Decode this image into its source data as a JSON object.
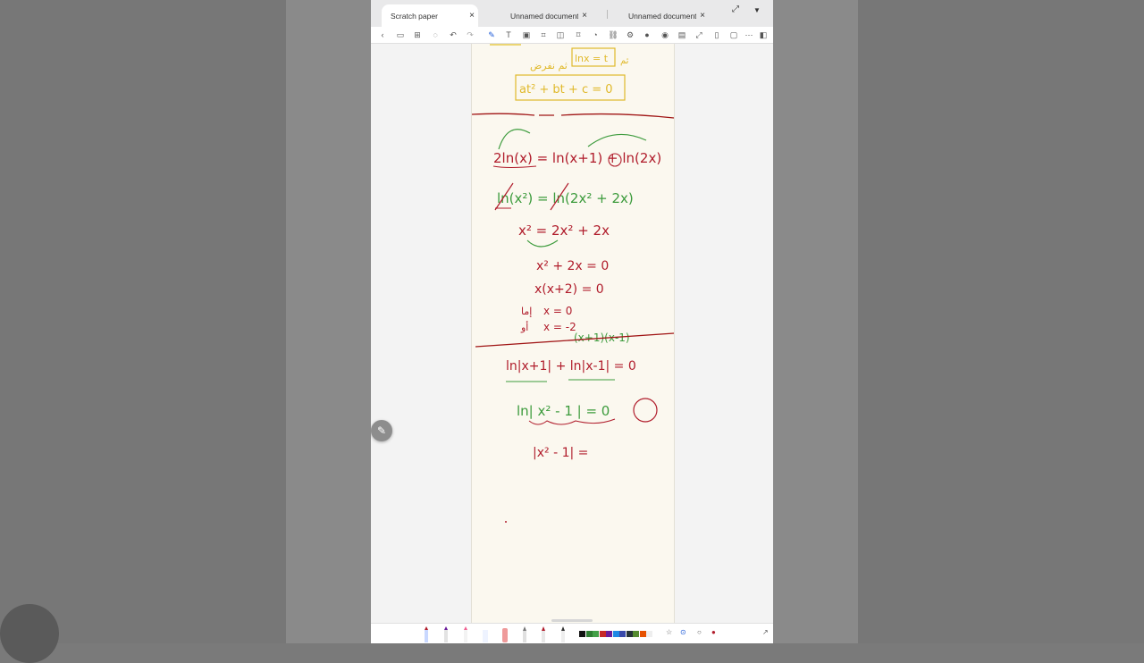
{
  "tabs": [
    {
      "label": "Scratch paper",
      "active": true
    },
    {
      "label": "Unnamed document",
      "active": false
    },
    {
      "label": "Unnamed document",
      "active": false
    }
  ],
  "tab_close_glyph": "×",
  "swatches": [
    "#111111",
    "#2e7d32",
    "#43a047",
    "#c62828",
    "#6a1b9a",
    "#1e88e5",
    "#3949ab",
    "#263238",
    "#558b2f",
    "#e65100",
    "#eeeeee"
  ],
  "handwriting": {
    "arabic_line1": "ثم نفرض",
    "box1": "lnx = t",
    "box2": "at² + bt + c = 0",
    "eq1": "2ln(x) = ln(x+1) + ln(2x)",
    "eq2": "ln(x²) = ln(2x² + 2x)",
    "eq3": "x² = 2x² + 2x",
    "eq4": "x² + 2x = 0",
    "eq5": "x(x+2) = 0",
    "eq6a": "x = 0",
    "eq6b": "x = -2",
    "eq7_green": "(x+1)(x-1)",
    "eq8": "ln|x+1| + ln|x-1| = 0",
    "eq9": "ln| x² - 1 | = 0",
    "eq10": "|x² - 1| ="
  }
}
